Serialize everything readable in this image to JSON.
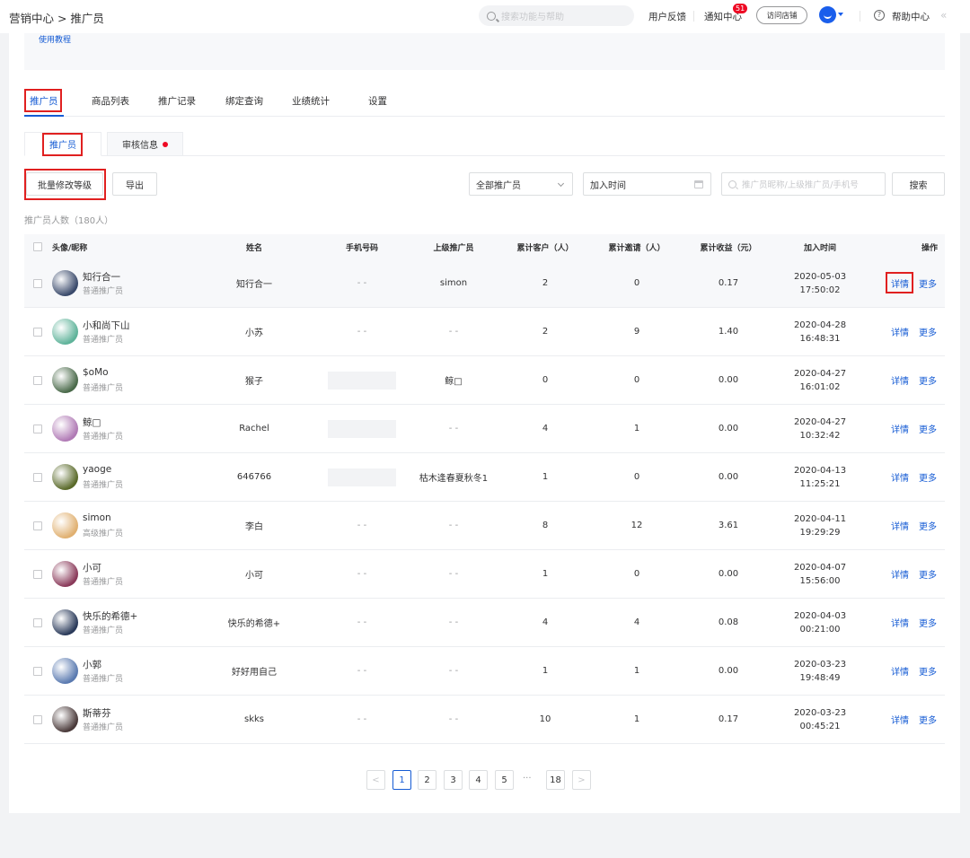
{
  "header": {
    "breadcrumb": "营销中心 > 推广员",
    "search_placeholder": "搜索功能与帮助",
    "feedback": "用户反馈",
    "notifications": "通知中心",
    "notification_count": "51",
    "visit_store": "访问店铺",
    "help": "帮助中心"
  },
  "notice": {
    "tutorial_link": "使用教程"
  },
  "tabs": [
    "推广员",
    "商品列表",
    "推广记录",
    "绑定查询",
    "业绩统计",
    "设置"
  ],
  "subtabs": [
    "推广员",
    "审核信息"
  ],
  "toolbar": {
    "batch_level": "批量修改等级",
    "export": "导出",
    "filter_select": "全部推广员",
    "join_time_placeholder": "加入时间",
    "search_placeholder": "推广员昵称/上级推广员/手机号",
    "search_button": "搜索"
  },
  "count_label": "推广员人数（180人）",
  "columns": [
    "头像/昵称",
    "姓名",
    "手机号码",
    "上级推广员",
    "累计客户（人）",
    "累计邀请（人）",
    "累计收益（元）",
    "加入时间",
    "操作"
  ],
  "actions": {
    "detail": "详情",
    "more": "更多"
  },
  "rows": [
    {
      "nick": "知行合一",
      "level": "普通推广员",
      "name": "知行合一",
      "phone": "- -",
      "phone_hidden": false,
      "superior": "simon",
      "customers": "2",
      "invites": "0",
      "earnings": "0.17",
      "date": "2020-05-03",
      "time": "17:50:02",
      "avatar_color": "#3a4a6b"
    },
    {
      "nick": "小和尚下山",
      "level": "普通推广员",
      "name": "小苏",
      "phone": "- -",
      "phone_hidden": false,
      "superior": "- -",
      "customers": "2",
      "invites": "9",
      "earnings": "1.40",
      "date": "2020-04-28",
      "time": "16:48:31",
      "avatar_color": "#5fb39a"
    },
    {
      "nick": "$oMo",
      "level": "普通推广员",
      "name": "猴子",
      "phone": "",
      "phone_hidden": true,
      "superior": "鲸□",
      "customers": "0",
      "invites": "0",
      "earnings": "0.00",
      "date": "2020-04-27",
      "time": "16:01:02",
      "avatar_color": "#4a6a4a"
    },
    {
      "nick": "鲸□",
      "level": "普通推广员",
      "name": "Rachel",
      "phone": "",
      "phone_hidden": true,
      "superior": "- -",
      "customers": "4",
      "invites": "1",
      "earnings": "0.00",
      "date": "2020-04-27",
      "time": "10:32:42",
      "avatar_color": "#b07ab5"
    },
    {
      "nick": "yaoge",
      "level": "普通推广员",
      "name": "646766",
      "phone": "",
      "phone_hidden": true,
      "superior": "枯木逢春夏秋冬1",
      "customers": "1",
      "invites": "0",
      "earnings": "0.00",
      "date": "2020-04-13",
      "time": "11:25:21",
      "avatar_color": "#5a6a2a"
    },
    {
      "nick": "simon",
      "level": "高级推广员",
      "name": "李白",
      "phone": "- -",
      "phone_hidden": false,
      "superior": "- -",
      "customers": "8",
      "invites": "12",
      "earnings": "3.61",
      "date": "2020-04-11",
      "time": "19:29:29",
      "avatar_color": "#e0b070"
    },
    {
      "nick": "小可",
      "level": "普通推广员",
      "name": "小可",
      "phone": "- -",
      "phone_hidden": false,
      "superior": "- -",
      "customers": "1",
      "invites": "0",
      "earnings": "0.00",
      "date": "2020-04-07",
      "time": "15:56:00",
      "avatar_color": "#8a3a5a"
    },
    {
      "nick": "快乐的希德+",
      "level": "普通推广员",
      "name": "快乐的希德+",
      "phone": "- -",
      "phone_hidden": false,
      "superior": "- -",
      "customers": "4",
      "invites": "4",
      "earnings": "0.08",
      "date": "2020-04-03",
      "time": "00:21:00",
      "avatar_color": "#2a3a5a"
    },
    {
      "nick": "小郭",
      "level": "普通推广员",
      "name": "好好用自己",
      "phone": "- -",
      "phone_hidden": false,
      "superior": "- -",
      "customers": "1",
      "invites": "1",
      "earnings": "0.00",
      "date": "2020-03-23",
      "time": "19:48:49",
      "avatar_color": "#5a7ab0"
    },
    {
      "nick": "斯蒂芬",
      "level": "普通推广员",
      "name": "skks",
      "phone": "- -",
      "phone_hidden": false,
      "superior": "- -",
      "customers": "10",
      "invites": "1",
      "earnings": "0.17",
      "date": "2020-03-23",
      "time": "00:45:21",
      "avatar_color": "#4a3a3a"
    }
  ],
  "pagination": {
    "pages": [
      "1",
      "2",
      "3",
      "4",
      "5"
    ],
    "ellipsis": "···",
    "last": "18",
    "current": "1",
    "prev": "<",
    "next": ">"
  },
  "colors": {
    "accent": "#155bd4",
    "highlight_box": "#e02020",
    "badge": "#ee0a24"
  }
}
